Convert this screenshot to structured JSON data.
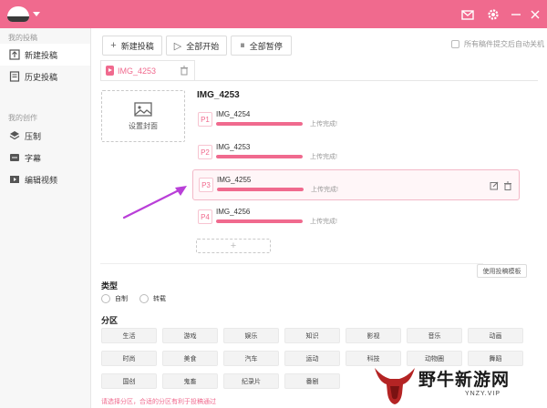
{
  "titlebar": {
    "brand_color": "#f06a8e"
  },
  "sidebar": {
    "section_contribute": "我的投稿",
    "section_create": "我的创作",
    "items": [
      {
        "label": "新建投稿",
        "icon": "upload-icon"
      },
      {
        "label": "历史投稿",
        "icon": "history-icon"
      },
      {
        "label": "压制",
        "icon": "layers-icon"
      },
      {
        "label": "字幕",
        "icon": "subtitle-icon"
      },
      {
        "label": "编辑视频",
        "icon": "video-edit-icon"
      }
    ]
  },
  "toolbar": {
    "new_post": "新建投稿",
    "start_all": "全部开始",
    "pause_all": "全部暂停",
    "auto_shutdown": "所有稿件提交后自动关机"
  },
  "tab": {
    "label": "IMG_4253"
  },
  "post": {
    "cover_label": "设置封面",
    "title": "IMG_4253",
    "parts": [
      {
        "badge": "P1",
        "name": "IMG_4254",
        "status": "上传完成!",
        "progress": 1.0
      },
      {
        "badge": "P2",
        "name": "IMG_4253",
        "status": "上传完成!",
        "progress": 1.0
      },
      {
        "badge": "P3",
        "name": "IMG_4255",
        "status": "上传完成!",
        "progress": 1.0
      },
      {
        "badge": "P4",
        "name": "IMG_4256",
        "status": "上传完成!",
        "progress": 1.0
      }
    ],
    "add_part": "+"
  },
  "template_button": "使用投稿模板",
  "type_section": {
    "label": "类型",
    "options": [
      "自制",
      "转载"
    ]
  },
  "category_section": {
    "label": "分区",
    "rows": [
      [
        "生活",
        "游戏",
        "娱乐",
        "知识",
        "影视",
        "音乐",
        "动画"
      ],
      [
        "时尚",
        "美食",
        "汽车",
        "运动",
        "科技",
        "动物圈",
        "舞蹈"
      ],
      [
        "国创",
        "鬼畜",
        "纪录片",
        "番剧",
        "",
        "",
        ""
      ]
    ],
    "hint": "请选择分区，合适的分区有利于投稿通过"
  },
  "watermark": {
    "title": "野牛新游网",
    "url": "YNZY.VIP"
  }
}
